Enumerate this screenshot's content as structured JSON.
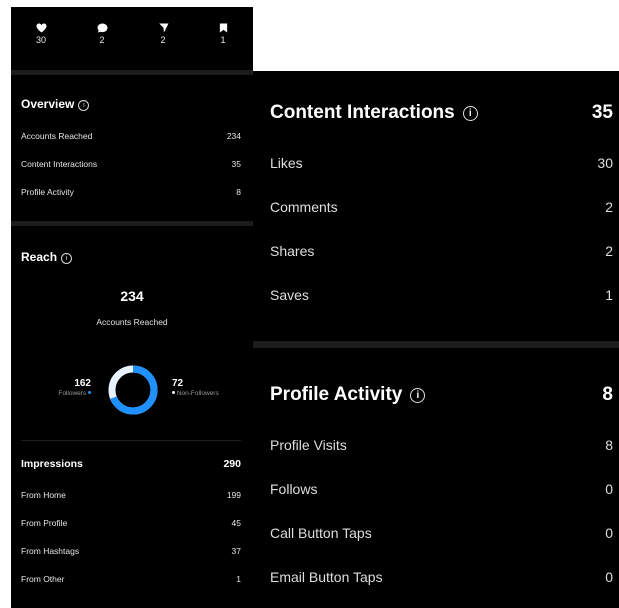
{
  "top_stats": [
    {
      "icon": "heart-icon",
      "value": "30"
    },
    {
      "icon": "comment-icon",
      "value": "2"
    },
    {
      "icon": "send-icon",
      "value": "2"
    },
    {
      "icon": "bookmark-icon",
      "value": "1"
    }
  ],
  "overview": {
    "title": "Overview",
    "rows": [
      {
        "label": "Accounts Reached",
        "value": "234"
      },
      {
        "label": "Content Interactions",
        "value": "35"
      },
      {
        "label": "Profile Activity",
        "value": "8"
      }
    ]
  },
  "reach": {
    "title": "Reach",
    "total": "234",
    "total_label": "Accounts Reached",
    "followers_value": "162",
    "followers_label": "Followers",
    "non_followers_value": "72",
    "non_followers_label": "Non-Followers",
    "followers_fraction": 0.69,
    "colors": {
      "followers": "#1e90ff",
      "non_followers": "#e8f2ff"
    }
  },
  "impressions": {
    "title": "Impressions",
    "total": "290",
    "rows": [
      {
        "label": "From Home",
        "value": "199"
      },
      {
        "label": "From Profile",
        "value": "45"
      },
      {
        "label": "From Hashtags",
        "value": "37"
      },
      {
        "label": "From Other",
        "value": "1"
      }
    ]
  },
  "content_interactions": {
    "title": "Content Interactions",
    "total": "35",
    "rows": [
      {
        "label": "Likes",
        "value": "30"
      },
      {
        "label": "Comments",
        "value": "2"
      },
      {
        "label": "Shares",
        "value": "2"
      },
      {
        "label": "Saves",
        "value": "1"
      }
    ]
  },
  "profile_activity": {
    "title": "Profile Activity",
    "total": "8",
    "rows": [
      {
        "label": "Profile Visits",
        "value": "8"
      },
      {
        "label": "Follows",
        "value": "0"
      },
      {
        "label": "Call Button Taps",
        "value": "0"
      },
      {
        "label": "Email Button Taps",
        "value": "0"
      }
    ]
  }
}
